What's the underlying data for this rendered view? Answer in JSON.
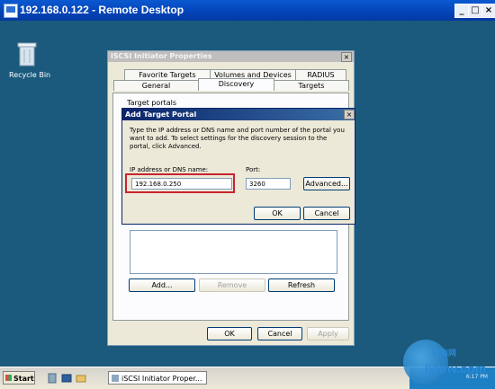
{
  "window": {
    "title": "192.168.0.122 - Remote Desktop"
  },
  "desktop": {
    "recycle_bin_label": "Recycle Bin"
  },
  "iscsi": {
    "title": "iSCSI Initiator Properties",
    "tabs_row1": [
      "Favorite Targets",
      "Volumes and Devices",
      "RADIUS"
    ],
    "tabs_row2": [
      "General",
      "Discovery",
      "Targets"
    ],
    "active_tab": "Discovery",
    "group_label": "Target portals",
    "add_label": "Add...",
    "remove_label": "Remove",
    "refresh_label": "Refresh",
    "ok_label": "OK",
    "cancel_label": "Cancel",
    "apply_label": "Apply"
  },
  "add_portal": {
    "title": "Add Target Portal",
    "description": "Type the IP address or DNS name and port number of the portal you want to add. To select settings for the discovery session to the portal, click Advanced.",
    "ip_label": "IP address or DNS name:",
    "ip_value": "192.168.0.250",
    "port_label": "Port:",
    "port_value": "3260",
    "advanced_label": "Advanced...",
    "ok_label": "OK",
    "cancel_label": "Cancel"
  },
  "taskbar": {
    "start_label": "Start",
    "task_label": "iSCSI Initiator Proper...",
    "clock": "6:17 PM"
  },
  "watermark": {
    "text": "云海网",
    "url": "iyunv.com"
  },
  "colors": {
    "desktop": "#1b5a7c",
    "titlebar": "#0443b8",
    "highlight": "#c8242e"
  }
}
